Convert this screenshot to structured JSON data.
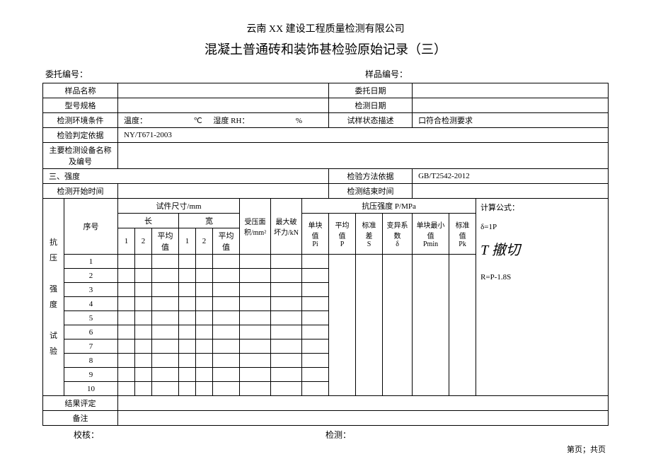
{
  "company": "云南 XX 建设工程质量检测有限公司",
  "title": "混凝土普通砖和装饰甚检验原始记录（三）",
  "meta": {
    "entrust_no_label": "委托编号：",
    "sample_no_label": "样品编号："
  },
  "rows": {
    "sample_name_label": "样品名称",
    "entrust_date_label": "委托日期",
    "model_spec_label": "型号规格",
    "test_date_label": "检测日期",
    "env_label": "检测环境条件",
    "env_temp_label": "温度：",
    "env_temp_unit": "℃",
    "env_humid_label": "湿度 RH：",
    "env_humid_unit": "%",
    "sample_state_label": "试样状态描述",
    "sample_state_value": "口符合检测要求",
    "judge_basis_label": "检验判定依据",
    "judge_basis_value": "NY/T671-2003",
    "equipment_label": "主要检测设备名称及编号",
    "section3_label": "三、强度",
    "method_basis_label": "检验方法依据",
    "method_basis_value": "GB/T2542-2012",
    "start_time_label": "检测开始时间",
    "end_time_label": "检测结束时间"
  },
  "grid": {
    "group_label": "抗压\n\n强度\n\n试验",
    "seq_label": "序号",
    "dimension_header": "试件尺寸/mm",
    "length_label": "长",
    "width_label": "宽",
    "col1": "1",
    "col2": "2",
    "avg_label": "平均值",
    "area_label": "受压面积/mm²",
    "max_force_label": "最大破坏力/kN",
    "strength_header": "抗压强度 P/MPa",
    "single_label": "单块值\nPi",
    "mean_label": "平均值\nP",
    "std_dev_label": "标准差\nS",
    "cv_label": "变异系数\nδ",
    "min_label": "单块最小值\nPmin",
    "std_val_label": "标准值\nPk",
    "formula_header": "计算公式：",
    "formula_line1": "δ=1P",
    "formula_big": "T 撤切",
    "formula_small": "R=P-1.8S",
    "rows": [
      "1",
      "2",
      "3",
      "4",
      "5",
      "6",
      "7",
      "8",
      "9",
      "10"
    ]
  },
  "result_label": "结果评定",
  "remark_label": "备注",
  "footer": {
    "check_label": "校核：",
    "test_label": "检测：",
    "page_label": "第页；共页"
  }
}
